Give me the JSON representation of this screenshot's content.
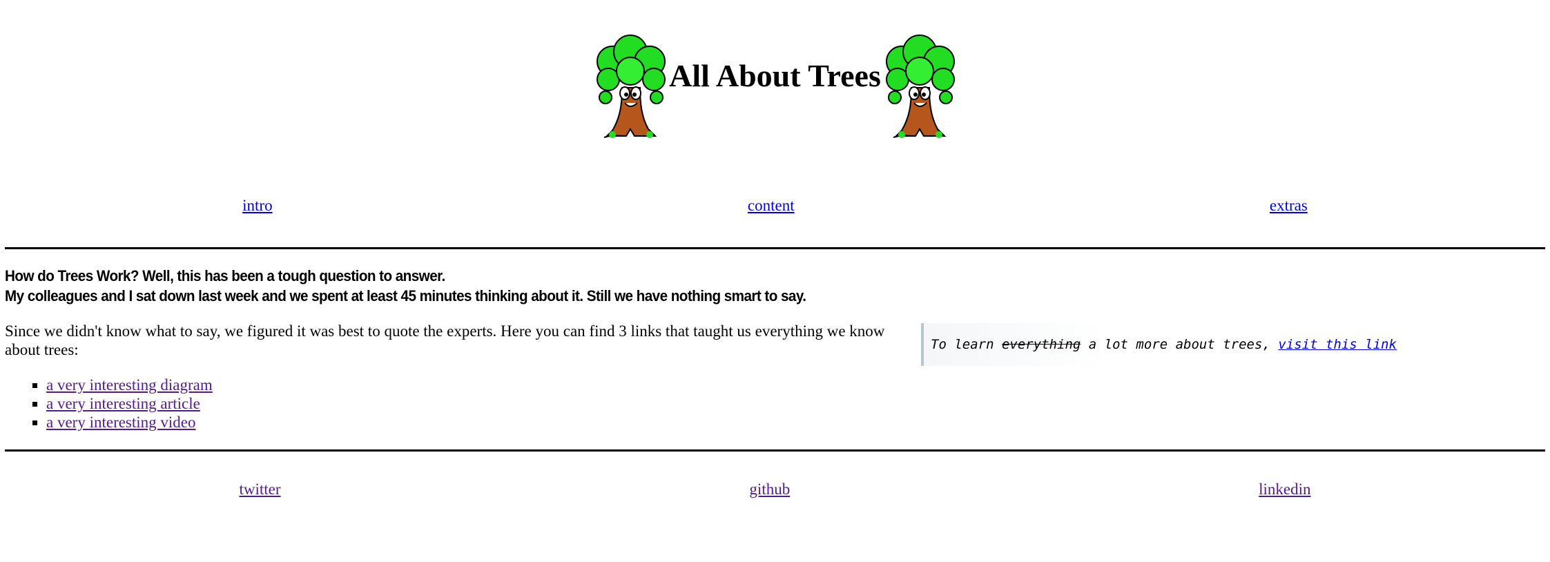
{
  "header": {
    "title": "All About Trees",
    "left_image": "tree-cartoon",
    "right_image": "tree-cartoon"
  },
  "nav_top": {
    "items": [
      "intro",
      "content",
      "extras"
    ]
  },
  "main": {
    "headline_line1": "How do Trees Work? Well, this has been a tough question to answer.",
    "headline_line2": "My colleagues and I sat down last week and we spent at least 45 minutes thinking about it. Still we have nothing smart to say.",
    "intro_text": "Since we didn't know what to say, we figured it was best to quote the experts. Here you can find 3 links that taught us everything we know about trees:",
    "links": [
      "a very interesting diagram",
      "a very interesting article",
      "a very interesting video"
    ]
  },
  "aside": {
    "prefix": "To learn ",
    "struck": "everything",
    "middle": " a lot more about trees, ",
    "link": "visit this link"
  },
  "nav_bottom": {
    "items": [
      "twitter",
      "github",
      "linkedin"
    ]
  },
  "colors": {
    "link": "#0000ee",
    "visited_link": "#551a8b",
    "tree_leaf": "#22dd22",
    "tree_trunk": "#b5561c"
  }
}
